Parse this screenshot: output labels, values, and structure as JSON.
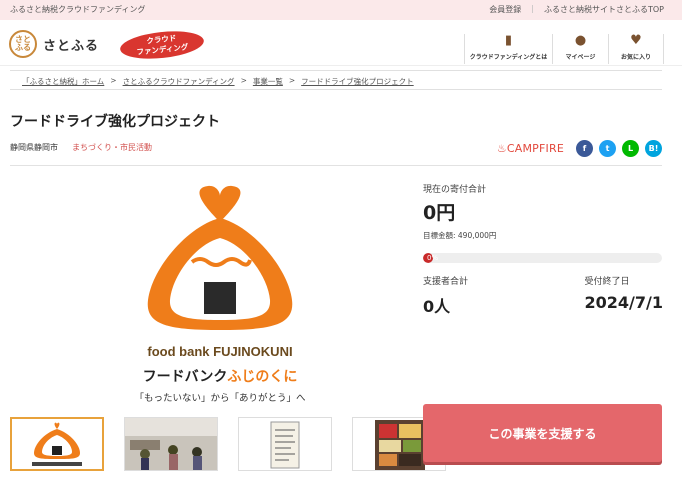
{
  "topbar": {
    "left_text": "ふるさと納税クラウドファンディング",
    "right_links": [
      "会員登録",
      "ふるさと納税サイトさとふるTOP"
    ]
  },
  "header": {
    "logo_mark": "さとふる",
    "logo_name": "さとふる",
    "badge_line1": "クラウド",
    "badge_line2": "ファンディング",
    "nav": [
      {
        "label": "クラウドファンディングとは",
        "icon": "book-icon"
      },
      {
        "label": "マイページ",
        "icon": "user-icon"
      },
      {
        "label": "お気に入り",
        "icon": "heart-icon"
      }
    ]
  },
  "breadcrumb": [
    "「ふるさと納税」ホーム",
    "さとふるクラウドファンディング",
    "事業一覧",
    "フードドライブ強化プロジェクト"
  ],
  "project": {
    "title": "フードドライブ強化プロジェクト",
    "location": "静岡県静岡市",
    "category": "まちづくり・市民活動",
    "partner": "CAMPFIRE"
  },
  "social": [
    {
      "name": "facebook",
      "glyph": "f"
    },
    {
      "name": "twitter",
      "glyph": "t"
    },
    {
      "name": "line",
      "glyph": "L"
    },
    {
      "name": "hatena",
      "glyph": "B!"
    }
  ],
  "hero": {
    "brand_en": "food bank FUJINOKUNI",
    "brand_jp_black": "フードバンク",
    "brand_jp_orange": "ふじのくに",
    "tagline": "「もったいない」から「ありがとう」へ"
  },
  "stats": {
    "current_label": "現在の寄付合計",
    "current_value": "0円",
    "target_text": "目標金額: 490,000円",
    "progress_percent": 0,
    "progress_text": "0%",
    "supporters_label": "支援者合計",
    "supporters_value": "0人",
    "deadline_label": "受付終了日",
    "deadline_value": "2024/7/1"
  },
  "cta": {
    "label": "この事業を支援する"
  },
  "colors": {
    "accent": "#e4676b",
    "brand_orange": "#ef7d1a",
    "badge_red": "#d9362f"
  }
}
